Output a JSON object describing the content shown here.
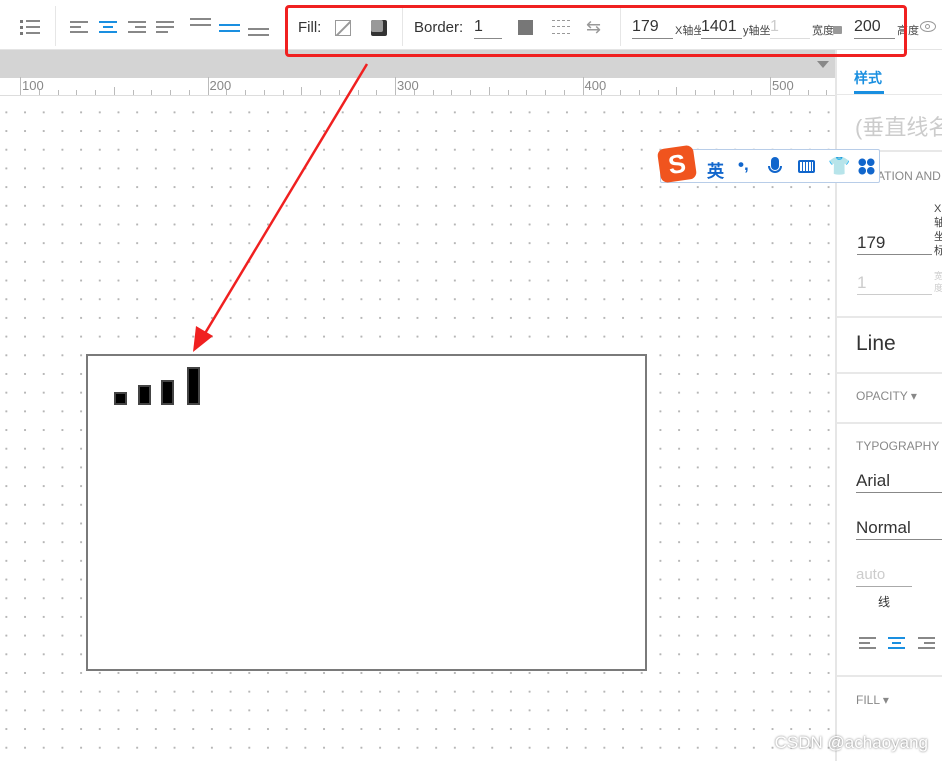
{
  "toolbar": {
    "fill_label": "Fill:",
    "border_label": "Border:",
    "border_width": "1",
    "x_value": "179",
    "x_label": "X轴坐",
    "y_value": "1401",
    "y_label": "y轴坐",
    "width_value": "1",
    "width_label": "宽度",
    "height_value": "200",
    "height_label": "高度"
  },
  "ruler": {
    "labels": [
      "100",
      "200",
      "300",
      "400",
      "500"
    ]
  },
  "panel": {
    "tab_style": "样式",
    "shape_name": "(垂直线名",
    "section_location": "ATION AND",
    "x_value": "179",
    "x_axis_label": "X轴坐标",
    "width_value": "1",
    "width_label": "宽度",
    "line_label": "Line",
    "opacity_label": "OPACITY ▾",
    "typography_label": "TYPOGRAPHY",
    "font_family": "Arial",
    "font_weight": "Normal",
    "line_height_placeholder": "auto",
    "line_height_label": "线",
    "fill_label": "FILL ▾"
  },
  "ime": {
    "logo": "S",
    "lang": "英",
    "punct": "•,"
  },
  "watermark": "CSDN @achaoyang",
  "colors": {
    "accent": "#1a8fe0",
    "highlight": "#f02020"
  }
}
